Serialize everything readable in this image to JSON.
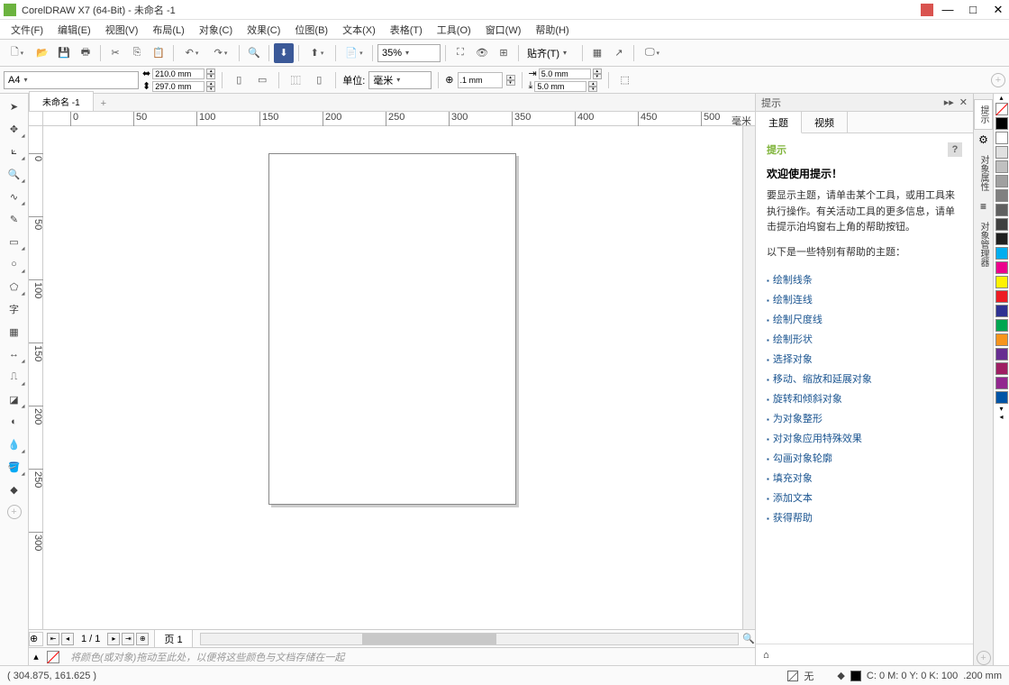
{
  "title": "CorelDRAW X7 (64-Bit) - 未命名 -1",
  "menu": [
    "文件(F)",
    "编辑(E)",
    "视图(V)",
    "布局(L)",
    "对象(C)",
    "效果(C)",
    "位图(B)",
    "文本(X)",
    "表格(T)",
    "工具(O)",
    "窗口(W)",
    "帮助(H)"
  ],
  "zoom": "35%",
  "snap_label": "贴齐(T)",
  "paper": {
    "size": "A4",
    "width": "210.0 mm",
    "height": "297.0 mm"
  },
  "units_label": "单位:",
  "units": "毫米",
  "nudge": ".1 mm",
  "dup_x": "5.0 mm",
  "dup_y": "5.0 mm",
  "doc_tab": "未命名 -1",
  "ruler_unit": "毫米",
  "page_nav": {
    "current": "1 / 1",
    "page_label": "页 1"
  },
  "hint_placeholder": "将颜色(或对象)拖动至此处，以便将这些颜色与文档存储在一起",
  "docker": {
    "title": "提示",
    "tabs": [
      "主题",
      "视频"
    ],
    "heading": "提示",
    "welcome": "欢迎使用提示！",
    "para": "要显示主题，请单击某个工具，或用工具来执行操作。有关活动工具的更多信息，请单击提示泊坞窗右上角的帮助按钮。",
    "list_intro": "以下是一些特别有帮助的主题：",
    "links": [
      "绘制线条",
      "绘制连线",
      "绘制尺度线",
      "绘制形状",
      "选择对象",
      "移动、缩放和延展对象",
      "旋转和倾斜对象",
      "为对象整形",
      "对对象应用特殊效果",
      "勾画对象轮廓",
      "填充对象",
      "添加文本",
      "获得帮助"
    ]
  },
  "side_tabs": [
    "提示",
    "对象属性",
    "对象管理器"
  ],
  "palette": [
    "#000000",
    "#ffffff",
    "#e0e0e0",
    "#c0c0c0",
    "#a0a0a0",
    "#808080",
    "#606060",
    "#404040",
    "#202020",
    "#00aeef",
    "#ec008c",
    "#fff200",
    "#ed1c24",
    "#2e3192",
    "#00a651",
    "#f7941d",
    "#662d91",
    "#9e1f63",
    "#92278f",
    "#0054a6"
  ],
  "status": {
    "coords": "( 304.875, 161.625 )",
    "none_label": "无",
    "color": "C: 0 M: 0 Y: 0 K: 100",
    "outline": ".200 mm"
  }
}
